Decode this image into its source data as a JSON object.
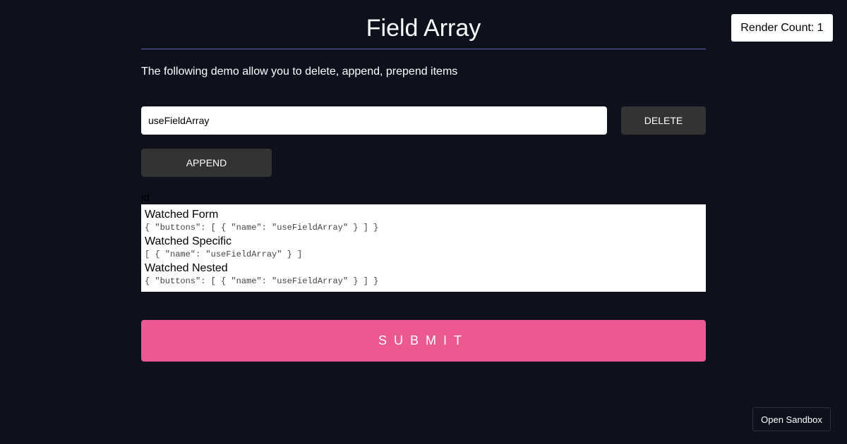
{
  "page": {
    "title": "Field Array",
    "description": "The following demo allow you to delete, append, prepend items"
  },
  "render_count": "Render Count: 1",
  "fields": {
    "input_value": "useFieldArray",
    "delete_label": "Delete",
    "append_label": "Append"
  },
  "id_label": "id",
  "watch": {
    "form_heading": "Watched Form",
    "form_value": "{ \"buttons\": [ { \"name\": \"useFieldArray\" } ] }",
    "specific_heading": "Watched Specific",
    "specific_value": "[ { \"name\": \"useFieldArray\" } ]",
    "nested_heading": "Watched Nested",
    "nested_value": "{ \"buttons\": [ { \"name\": \"useFieldArray\" } ] }"
  },
  "submit_label": "Submit",
  "sandbox_label": "Open Sandbox",
  "colors": {
    "background": "#0e101c",
    "accent": "#ec5990",
    "rule": "#5b62b8",
    "button_dark": "#333333"
  }
}
